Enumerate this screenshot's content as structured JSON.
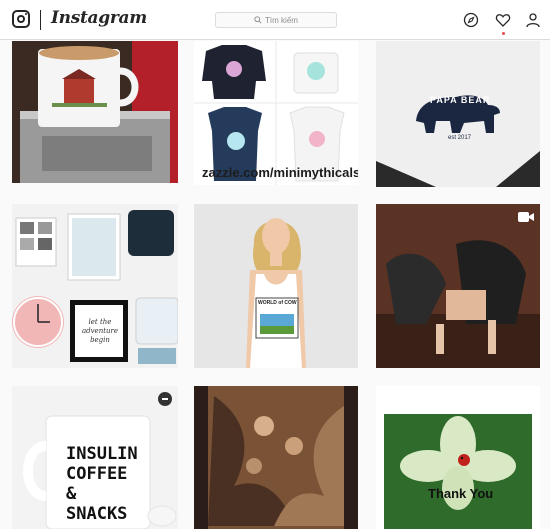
{
  "header": {
    "brand": "Instagram",
    "search_placeholder": "Tìm kiếm",
    "icons": [
      "instagram-logo-icon",
      "search-icon",
      "compass-icon",
      "heart-icon",
      "user-icon"
    ],
    "notification_color": "#ed4956"
  },
  "feed": {
    "tiles": [
      {
        "subject": "coffee mug on espresso machine"
      },
      {
        "subject": "unicorn apparel collage",
        "caption": "zazzle.com/minimythicals"
      },
      {
        "subject": "papa bear t-shirt",
        "line1": "PAPA BEAR",
        "line2": "est 2017"
      },
      {
        "subject": "stationery set",
        "script": "let the adventure begin"
      },
      {
        "subject": "woman in tank top",
        "shirt_title": "WORLD of COW"
      },
      {
        "subject": "people on porch",
        "badge": "video-icon"
      },
      {
        "subject": "insulin coffee mug",
        "words": [
          "INSULIN",
          "COFFEE",
          "&",
          "SNACKS"
        ],
        "badge": "tip-icon"
      },
      {
        "subject": "painting on shirt"
      },
      {
        "subject": "flower thank you card",
        "card_text": "Thank You"
      }
    ]
  }
}
